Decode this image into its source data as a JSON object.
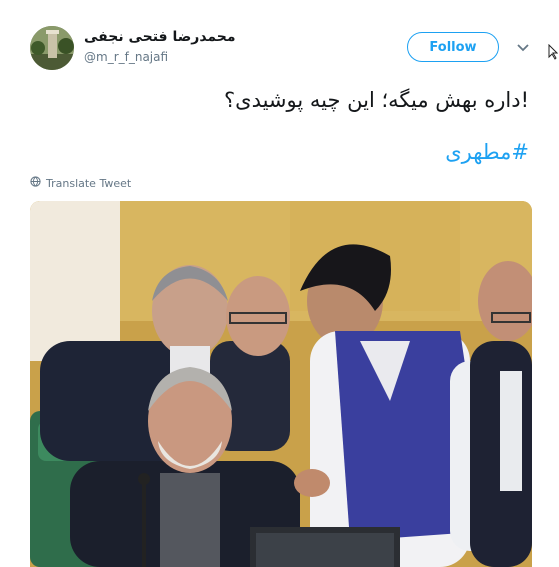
{
  "tweet": {
    "display_name": "محمدرضا فتحی نجفی",
    "username": "@m_r_f_najafi",
    "follow_label": "Follow",
    "text": "!داره بهش میگه؛ این چیه پوشیدی؟",
    "hashtag": "#مطهری",
    "translate_label": "Translate Tweet"
  },
  "icons": {
    "menu": "chevron-down-icon",
    "translate": "globe-icon"
  },
  "colors": {
    "accent": "#1da1f2",
    "secondary_text": "#657786",
    "primary_text": "#14171a"
  }
}
